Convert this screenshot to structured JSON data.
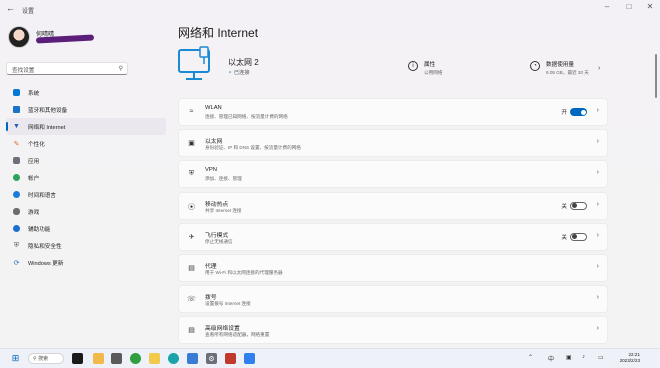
{
  "app": {
    "title": "设置"
  },
  "user": {
    "name": "何晴晴"
  },
  "search": {
    "placeholder": "查找设置"
  },
  "sidebar": {
    "items": [
      {
        "label": "系统",
        "icon": "monitor-icon",
        "color": "#0078d4"
      },
      {
        "label": "蓝牙和其他设备",
        "icon": "bluetooth-devices-icon",
        "color": "#1a73c9"
      },
      {
        "label": "网络和 Internet",
        "icon": "network-icon",
        "color": "#1a5fb4",
        "active": true
      },
      {
        "label": "个性化",
        "icon": "brush-icon",
        "color": "#e06c3a"
      },
      {
        "label": "应用",
        "icon": "apps-icon",
        "color": "#6b6f7a"
      },
      {
        "label": "帐户",
        "icon": "person-icon",
        "color": "#2aa45a"
      },
      {
        "label": "时间和语言",
        "icon": "globe-clock-icon",
        "color": "#1a7bd8"
      },
      {
        "label": "游戏",
        "icon": "gamepad-icon",
        "color": "#6d6d6d"
      },
      {
        "label": "辅助功能",
        "icon": "accessibility-icon",
        "color": "#1a6fd0"
      },
      {
        "label": "隐私和安全性",
        "icon": "shield-icon",
        "color": "#5a5f6a"
      },
      {
        "label": "Windows 更新",
        "icon": "update-icon",
        "color": "#1a73c9"
      }
    ]
  },
  "main": {
    "title": "网络和 Internet",
    "ethernet": {
      "name": "以太网 2",
      "status": "已连接"
    },
    "properties": {
      "label": "属性",
      "sub": "公用网络"
    },
    "usage": {
      "label": "数据使用量",
      "sub": "9.05 GB，最近 30 天"
    },
    "rows": [
      {
        "icon": "wifi-icon",
        "title": "WLAN",
        "sub": "连接、管理已知网络、按流量计费的网络",
        "toggle": "开",
        "toggle_on": true
      },
      {
        "icon": "ethernet-icon",
        "title": "以太网",
        "sub": "身份验证、IP 和 DNS 设置、按流量计费的网络"
      },
      {
        "icon": "vpn-icon",
        "title": "VPN",
        "sub": "添加、连接、管理"
      },
      {
        "icon": "hotspot-icon",
        "title": "移动热点",
        "sub": "共享 Internet 连接",
        "toggle": "关",
        "toggle_on": false
      },
      {
        "icon": "airplane-icon",
        "title": "飞行模式",
        "sub": "停止无线通信",
        "toggle": "关",
        "toggle_on": false
      },
      {
        "icon": "proxy-icon",
        "title": "代理",
        "sub": "用于 Wi-Fi 和以太网连接的代理服务器"
      },
      {
        "icon": "dialup-icon",
        "title": "拨号",
        "sub": "设置拨号 Internet 连接"
      },
      {
        "icon": "advanced-network-icon",
        "title": "高级网络设置",
        "sub": "查看所有网络适配器，网络重置"
      }
    ]
  },
  "taskbar": {
    "search_label": "搜索",
    "clock_time": "22:21",
    "clock_date": "2023/2/23"
  }
}
